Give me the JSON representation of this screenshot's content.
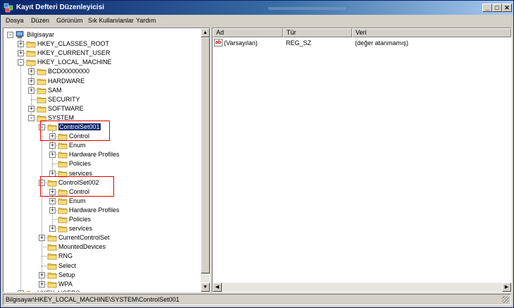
{
  "window": {
    "title": "Kayıt Defteri Düzenleyicisi",
    "min_label": "_",
    "max_label": "□",
    "close_label": "✕"
  },
  "menu": [
    "Dosya",
    "Düzen",
    "Görünüm",
    "Sık Kullanılanlar",
    "Yardım"
  ],
  "tree": [
    {
      "label": "Bilgisayar",
      "depth": 0,
      "exp": "-",
      "icon": "computer"
    },
    {
      "label": "HKEY_CLASSES_ROOT",
      "depth": 1,
      "exp": "+"
    },
    {
      "label": "HKEY_CURRENT_USER",
      "depth": 1,
      "exp": "+"
    },
    {
      "label": "HKEY_LOCAL_MACHINE",
      "depth": 1,
      "exp": "-"
    },
    {
      "label": "BCD00000000",
      "depth": 2,
      "exp": "+"
    },
    {
      "label": "HARDWARE",
      "depth": 2,
      "exp": "+"
    },
    {
      "label": "SAM",
      "depth": 2,
      "exp": "+"
    },
    {
      "label": "SECURITY",
      "depth": 2,
      "exp": ""
    },
    {
      "label": "SOFTWARE",
      "depth": 2,
      "exp": "+"
    },
    {
      "label": "SYSTEM",
      "depth": 2,
      "exp": "-"
    },
    {
      "label": "ControlSet001",
      "depth": 3,
      "exp": "-",
      "selected": true
    },
    {
      "label": "Control",
      "depth": 4,
      "exp": "+"
    },
    {
      "label": "Enum",
      "depth": 4,
      "exp": "+"
    },
    {
      "label": "Hardware Profiles",
      "depth": 4,
      "exp": "+"
    },
    {
      "label": "Policies",
      "depth": 4,
      "exp": ""
    },
    {
      "label": "services",
      "depth": 4,
      "exp": "+"
    },
    {
      "label": "ControlSet002",
      "depth": 3,
      "exp": "-"
    },
    {
      "label": "Control",
      "depth": 4,
      "exp": "+"
    },
    {
      "label": "Enum",
      "depth": 4,
      "exp": "+"
    },
    {
      "label": "Hardware Profiles",
      "depth": 4,
      "exp": "+"
    },
    {
      "label": "Policies",
      "depth": 4,
      "exp": ""
    },
    {
      "label": "services",
      "depth": 4,
      "exp": "+"
    },
    {
      "label": "CurrentControlSet",
      "depth": 3,
      "exp": "+"
    },
    {
      "label": "MountedDevices",
      "depth": 3,
      "exp": ""
    },
    {
      "label": "RNG",
      "depth": 3,
      "exp": ""
    },
    {
      "label": "Select",
      "depth": 3,
      "exp": ""
    },
    {
      "label": "Setup",
      "depth": 3,
      "exp": "+"
    },
    {
      "label": "WPA",
      "depth": 3,
      "exp": "+"
    },
    {
      "label": "HKEY_USERS",
      "depth": 1,
      "exp": "+"
    }
  ],
  "list": {
    "headers": [
      "Ad",
      "Tür",
      "Veri"
    ],
    "rows": [
      {
        "name": "(Varsayılan)",
        "type": "REG_SZ",
        "data": "(değer atanmamış)",
        "icon_text": "ab"
      }
    ]
  },
  "scroll": {
    "up": "▲",
    "down": "▼",
    "left": "◀",
    "right": "▶"
  },
  "statusbar": "Bilgisayar\\HKEY_LOCAL_MACHINE\\SYSTEM\\ControlSet001",
  "colors": {
    "title_start": "#0a246a",
    "title_end": "#a6caf0",
    "selection": "#0a246a",
    "highlight_box": "#e00000",
    "folder": "#f3c94a"
  }
}
